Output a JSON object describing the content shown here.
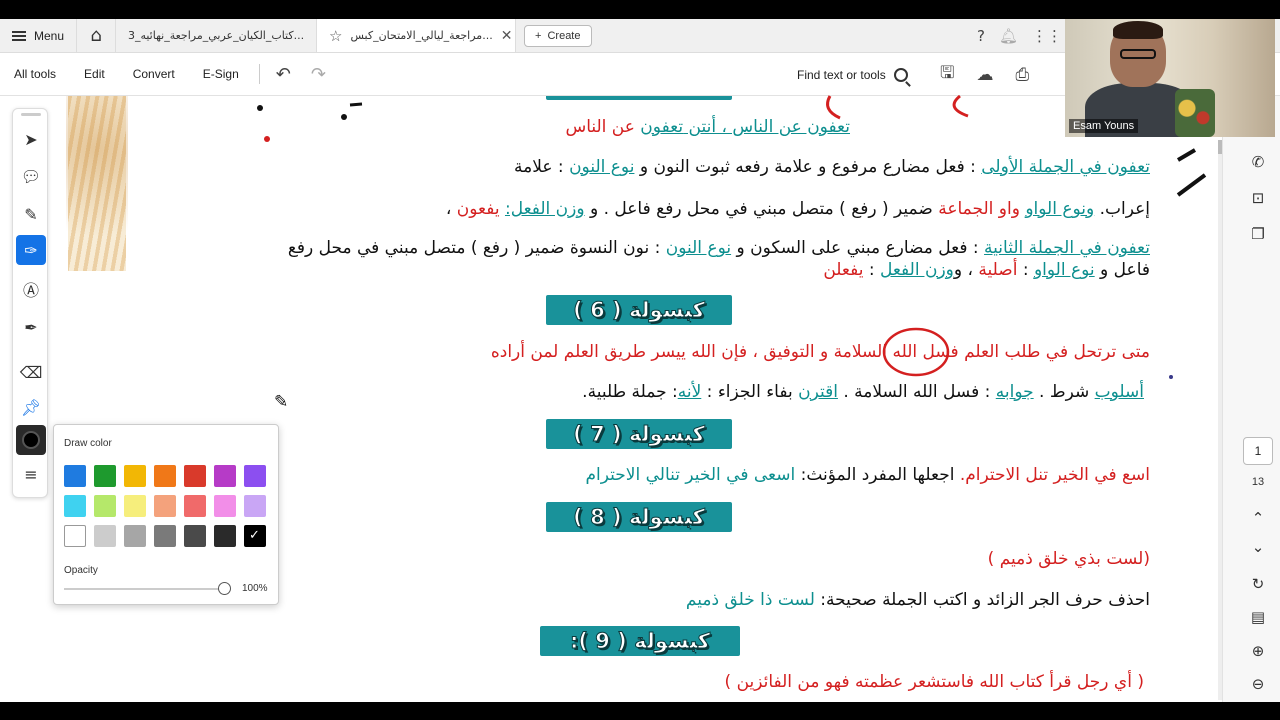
{
  "tabbar": {
    "menu_label": "Menu",
    "tabs": [
      {
        "label": "كتاب_الكيان_عربي_مراجعة_نهائيه_3..."
      },
      {
        "label": "مراجعة_ليالي_الامتحان_كبس..."
      }
    ],
    "create_label": "Create"
  },
  "toolbar": {
    "all_tools": "All tools",
    "edit": "Edit",
    "convert": "Convert",
    "esign": "E-Sign",
    "find": "Find text or tools"
  },
  "document": {
    "line1": {
      "part1": "تعفون عن الناس ، أنتن ",
      "part2": "تعفون",
      "part3": " عن الناس"
    },
    "line2": {
      "p1": "تعفون في الجملة الأولى",
      "p2": " : فعل مضارع مرفوع و علامة رفعه ثبوت النون  و ",
      "p3": "نوع النون",
      "p4": " : علامة"
    },
    "line3": {
      "p1": "إعراب. ",
      "p2": "ونوع الواو",
      "p3": " واو الجماعة",
      "p4": " ضمير ( رفع ) متصل مبني في محل رفع فاعل . و ",
      "p5": "وزن الفعل:",
      "p6": " يفعون",
      "p7": " ،"
    },
    "line4": {
      "p1": "تعفون في الجملة الثانية",
      "p2": " : فعل مضارع مبني على السكون و ",
      "p3": "نوع النون",
      "p4": " : نون النسوة ضمير ( رفع ) متصل مبني في محل رفع"
    },
    "line5": {
      "p1": "فاعل و ",
      "p2": "نوع الواو",
      "p3": " : ",
      "p4": "أصلية",
      "p5": " ، و",
      "p6": "وزن الفعل",
      "p7": " : ",
      "p8": "يفعلن"
    },
    "banner6": "كبسولة ( 6 )",
    "q6": "متى ترتحل في طلب العلم فسل الله السلامة و التوفيق ، فإن الله ييسر طريق العلم لمن أراده",
    "a6": {
      "p1": "أسلوب",
      "p2": " شرط . ",
      "p3": "جوابه",
      "p4": " : فسل الله السلامة . ",
      "p5": "اقترن",
      "p6": " بفاء الجزاء : ",
      "p7": "لأنه",
      "p8": ": جملة طلبية."
    },
    "banner7": "كبسولة ( 7 )",
    "q7": {
      "p1": "اسع في الخير تنل الاحترام.",
      "p2": " اجعلها المفرد المؤنث:  ",
      "p3": "اسعى في الخير تنالي الاحترام"
    },
    "banner8": "كبسولة ( 8 )",
    "q8a": "(لست بذي خلق ذميم )",
    "q8b": {
      "p1": "احذف حرف الجر الزائد و اكتب الجملة صحيحة:  ",
      "p2": "لست ذا خلق ذميم"
    },
    "banner9": "كبسولة ( 9 ):",
    "q9": "( أي رجل قرأ كتاب الله فاستشعر عظمته فهو من الفائزين )"
  },
  "colorpop": {
    "title": "Draw color",
    "opacity_label": "Opacity",
    "opacity_value": "100%",
    "opacity_fraction": 1.0,
    "swatches": [
      [
        "#1f7be0",
        "#1e9a2e",
        "#f2b705",
        "#f07818",
        "#d93a2b",
        "#b63bc7",
        "#8c4ff0"
      ],
      [
        "#3fd2f0",
        "#b5e86a",
        "#f6ee7c",
        "#f4a27c",
        "#f06a6a",
        "#f28ee8",
        "#c9a6f5"
      ],
      [
        "#ffffff",
        "#cccccc",
        "#a6a6a6",
        "#7a7a7a",
        "#4a4a4a",
        "#2a2a2a",
        "#000000"
      ]
    ],
    "selected": "#000000"
  },
  "pagenav": {
    "current": "1",
    "total": "13"
  },
  "webcam": {
    "name": "Esam Youns"
  },
  "colors": {
    "teal": "#0d8f8f",
    "red": "#d42020",
    "banner": "#19929a",
    "accent": "#1473e6"
  }
}
